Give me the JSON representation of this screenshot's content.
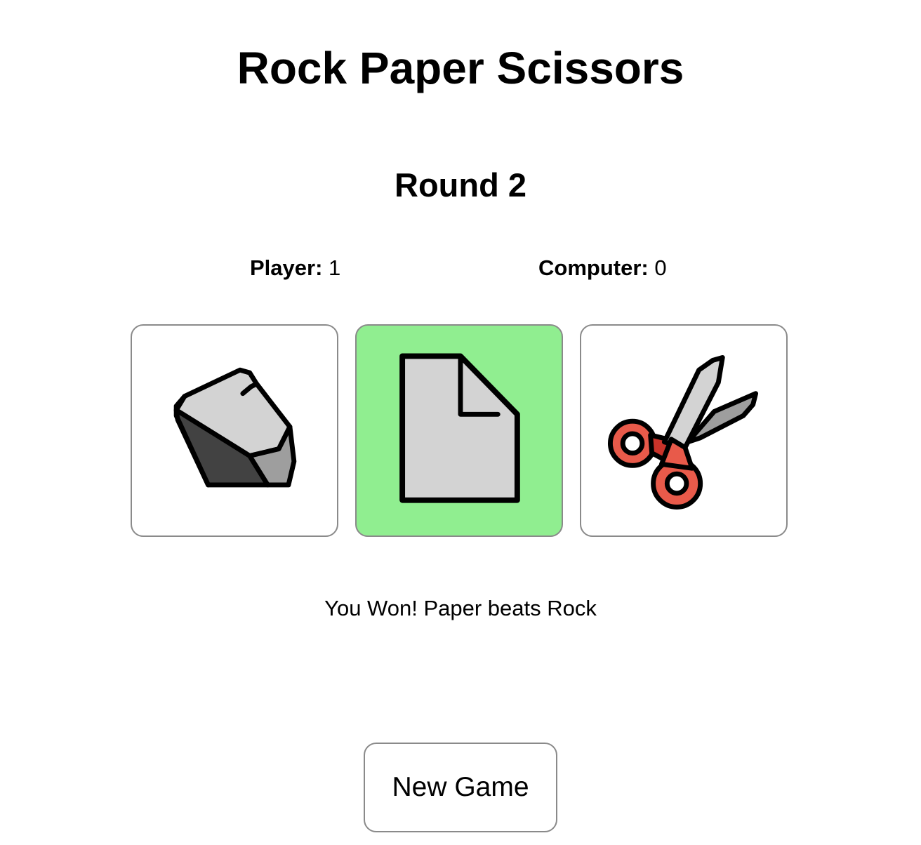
{
  "header": {
    "title": "Rock Paper Scissors"
  },
  "round": {
    "label": "Round 2"
  },
  "scores": {
    "player_label": "Player:",
    "player_value": "1",
    "computer_label": "Computer:",
    "computer_value": "0"
  },
  "choices": [
    {
      "name": "Rock",
      "icon": "rock-icon",
      "selected": false
    },
    {
      "name": "Paper",
      "icon": "paper-icon",
      "selected": true
    },
    {
      "name": "Scissors",
      "icon": "scissors-icon",
      "selected": false
    }
  ],
  "result": {
    "message": "You Won! Paper beats Rock"
  },
  "controls": {
    "new_game_label": "New Game"
  },
  "colors": {
    "selected_background": "#90ee90",
    "card_border": "#8a8a8a"
  }
}
